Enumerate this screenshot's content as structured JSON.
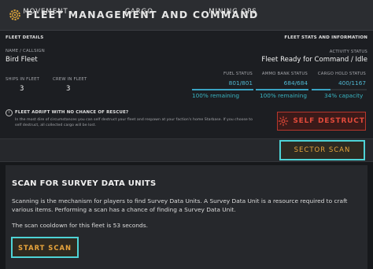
{
  "window": {
    "title": "FLEET MANAGEMENT AND COMMAND"
  },
  "fleet_details": {
    "section_label": "FLEET DETAILS",
    "name_label": "NAME / CALLSIGN",
    "name_value": "Bird Fleet",
    "ships_label": "SHIPS IN FLEET",
    "ships_value": "3",
    "crew_label": "CREW IN FLEET",
    "crew_value": "3"
  },
  "fleet_stats": {
    "section_label": "FLEET STATS AND INFORMATION",
    "activity_label": "ACTIVITY STATUS",
    "activity_value": "Fleet Ready for Command / Idle",
    "fuel": {
      "label": "FUEL STATUS",
      "value": "801/801",
      "remaining": "100% remaining",
      "fraction": 1.0
    },
    "ammo": {
      "label": "AMMO BANK STATUS",
      "value": "684/684",
      "remaining": "100% remaining",
      "fraction": 1.0
    },
    "cargo": {
      "label": "CARGO HOLD STATUS",
      "value": "400/1167",
      "remaining": "34% capacity",
      "fraction": 0.34
    }
  },
  "adrift": {
    "icon": "info-icon",
    "icon_glyph": "i",
    "title": "FLEET ADRIFT WITH NO CHANCE OF RESCUE?",
    "body": "In the most dire of circumstances you can self destruct your fleet and respawn at your faction's home Starbase. If you choose to self destruct, all collected cargo will be lost."
  },
  "self_destruct": {
    "label": "SELF DESTRUCT",
    "icon": "self-destruct-icon",
    "color": "#e24a3a"
  },
  "tabs": [
    {
      "label": "MOVEMENT",
      "active": false
    },
    {
      "label": "CARGO",
      "active": false
    },
    {
      "label": "MINING OPS",
      "active": false
    },
    {
      "label": "SECTOR SCAN",
      "active": true
    }
  ],
  "scan_panel": {
    "title": "SCAN FOR SURVEY DATA UNITS",
    "description": "Scanning is the mechanism for players to find Survey Data Units. A Survey Data Unit is a resource required to craft various items. Performing a scan has a chance of finding a Survey Data Unit.",
    "cooldown": "The scan cooldown for this fleet is 53 seconds.",
    "button_label": "START SCAN"
  },
  "colors": {
    "accent": "#4ed3d6",
    "highlight": "#e8a53c",
    "stat": "#4fb6d0",
    "danger": "#b7362c"
  }
}
